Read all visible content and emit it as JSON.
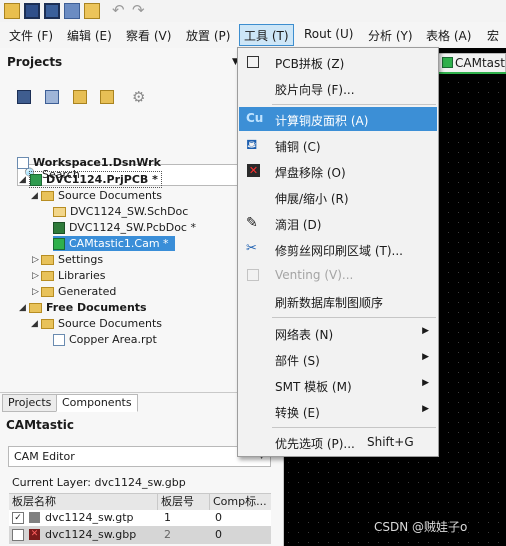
{
  "toolbar": {
    "icons": [
      "folder-icon",
      "save-icon",
      "save-all-icon",
      "open-folder-icon",
      "folder-up-icon",
      "undo-icon",
      "redo-icon"
    ]
  },
  "menubar": {
    "items": [
      {
        "label": "文件 (F)"
      },
      {
        "label": "编辑 (E)"
      },
      {
        "label": "察看 (V)"
      },
      {
        "label": "放置 (P)"
      },
      {
        "label": "工具 (T)"
      },
      {
        "label": "Rout (U)"
      },
      {
        "label": "分析 (Y)"
      },
      {
        "label": "表格 (A)"
      },
      {
        "label": "宏"
      }
    ]
  },
  "projects_panel": {
    "title": "Projects",
    "search_placeholder": "Search",
    "tree": {
      "workspace": "Workspace1.DsnWrk",
      "project": "DVC1124.PrjPCB *",
      "source_documents": "Source Documents",
      "sch_doc": "DVC1124_SW.SchDoc",
      "pcb_doc": "DVC1124_SW.PcbDoc *",
      "cam_doc": "CAMtastic1.Cam *",
      "settings": "Settings",
      "libraries": "Libraries",
      "generated": "Generated",
      "free_documents": "Free Documents",
      "free_source_documents": "Source Documents",
      "copper_rpt": "Copper Area.rpt"
    },
    "tabs": [
      "Projects",
      "Components"
    ]
  },
  "camtastic_panel": {
    "title": "CAMtastic",
    "editor_select": "CAM Editor",
    "current_layer_label": "Current Layer: dvc1124_sw.gbp",
    "table": {
      "headers": [
        "板层名称",
        "板层号",
        "Comp标..."
      ],
      "rows": [
        {
          "name": "dvc1124_sw.gtp",
          "num": "1",
          "comp": "0",
          "checked": true
        },
        {
          "name": "dvc1124_sw.gbp",
          "num": "2",
          "comp": "0",
          "checked": false
        }
      ]
    }
  },
  "document_tab": {
    "label": "CAMtastic"
  },
  "tools_menu": {
    "items": [
      {
        "label": "PCB拼板 (Z)"
      },
      {
        "label": "胶片向导 (F)..."
      },
      {
        "label": "计算铜皮面积 (A)"
      },
      {
        "label": "铺铜 (C)"
      },
      {
        "label": "焊盘移除 (O)"
      },
      {
        "label": "伸展/缩小 (R)"
      },
      {
        "label": "滴泪 (D)"
      },
      {
        "label": "修剪丝网印刷区域 (T)..."
      },
      {
        "label": "Venting (V)..."
      },
      {
        "label": "刷新数据库制图顺序"
      },
      {
        "label": "网络表 (N)"
      },
      {
        "label": "部件 (S)"
      },
      {
        "label": "SMT 模板 (M)"
      },
      {
        "label": "转换 (E)"
      },
      {
        "label": "优先选项 (P)...",
        "shortcut": "Shift+G"
      }
    ]
  },
  "watermark": "CSDN @贼娃子o",
  "colors": {
    "highlight": "#3c8fd6",
    "canvas": "#000000",
    "accent_green": "#2fb04b"
  }
}
